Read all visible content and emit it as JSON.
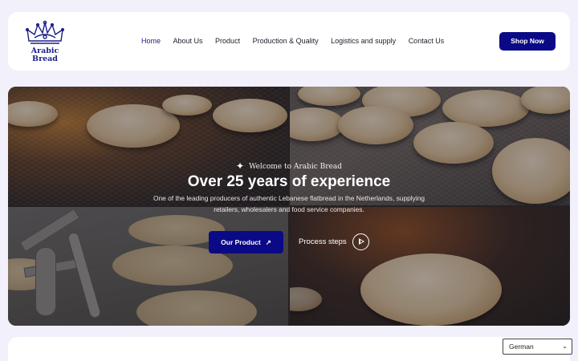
{
  "brand": {
    "logo_line1": "Arabic",
    "logo_line2": "Bread"
  },
  "nav": {
    "items": [
      "Home",
      "About Us",
      "Product",
      "Production & Quality",
      "Logistics and supply",
      "Contact Us"
    ],
    "active": "Home"
  },
  "header": {
    "cta_label": "Shop Now"
  },
  "hero": {
    "welcome": "Welcome to Arabic Bread",
    "title": "Over 25 years of experience",
    "description_line1": "One of the leading producers of authentic Lebanese flatbread in the Netherlands, supplying",
    "description_line2": "retailers, wholesalers and food service companies.",
    "primary_button": "Our Product",
    "secondary_link": "Process steps"
  },
  "language_select": {
    "selected": "German"
  },
  "colors": {
    "brand_navy": "#0b0a86",
    "logo_blue": "#1b1e85",
    "page_background": "#f2f0fa"
  },
  "icons": [
    "crown-logo-icon",
    "arrow-up-right-icon",
    "play-circle-icon",
    "sparkle-icon",
    "chevron-down-icon"
  ]
}
